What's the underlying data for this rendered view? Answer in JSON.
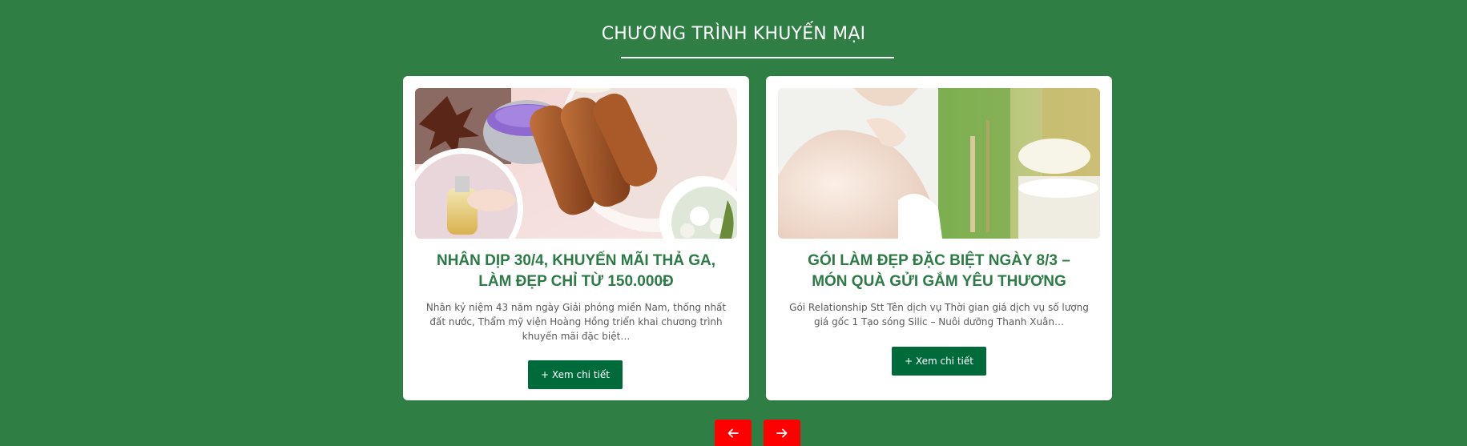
{
  "section": {
    "title": "CHƯƠNG TRÌNH KHUYẾN MẠI"
  },
  "cards": [
    {
      "title": "NHÂN DỊP 30/4, KHUYẾN MÃI THẢ GA, LÀM ĐẸP CHỈ TỪ 150.000Đ",
      "description": "Nhân kỷ niệm 43 năm ngày Giải phóng miền Nam, thống nhất đất nước, Thẩm mỹ viện Hoàng Hồng triển khai chương trình khuyến mãi đặc biệt…",
      "button_label": "+ Xem chi tiết",
      "image_icon": "spa-cinnamon-candle-image"
    },
    {
      "title": "GÓI LÀM ĐẸP ĐẶC BIỆT NGÀY 8/3 – MÓN QUÀ GỬI GẮM YÊU THƯƠNG",
      "description": "Gói Relationship Stt Tên dịch vụ Thời gian giá dịch vụ số lượng giá gốc 1 Tạo sóng Silic – Nuôi dưỡng Thanh Xuân…",
      "button_label": "+ Xem chi tiết",
      "image_icon": "spa-woman-back-image"
    }
  ],
  "carousel": {
    "prev_icon": "arrow-left-icon",
    "next_icon": "arrow-right-icon"
  },
  "colors": {
    "background": "#2f7f45",
    "card_title": "#2c7a45",
    "button": "#006b3a",
    "nav_button": "#ff0000"
  }
}
